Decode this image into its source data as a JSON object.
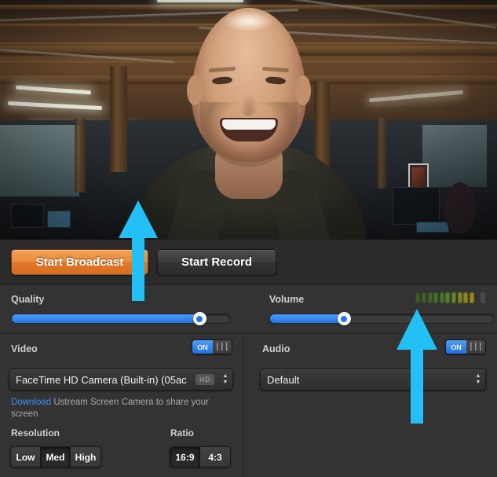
{
  "preview": {
    "name": "webcam-preview",
    "description": "Live webcam preview of a smiling bald man in an open-plan office with exposed wooden ceiling beams"
  },
  "buttons": {
    "broadcast_label": "Start Broadcast",
    "record_label": "Start Record",
    "broadcast_color": "#e8872f",
    "record_color": "#3a3a3a"
  },
  "quality": {
    "label": "Quality",
    "value_percent": 86,
    "accent": "#2176e8"
  },
  "volume": {
    "label": "Volume",
    "value_percent": 33,
    "accent": "#2176e8",
    "meter": {
      "segments": 10,
      "colors": [
        "#3f5c2a",
        "#41612b",
        "#44672c",
        "#48702d",
        "#4c772e",
        "#56832f",
        "#66862c",
        "#7d8a27",
        "#8e8a22",
        "#9a8a1e"
      ],
      "peak_color": "#4a4a4a"
    }
  },
  "video_panel": {
    "title": "Video",
    "toggle": {
      "on_label": "ON",
      "off_icon": "pause-bars-icon",
      "state": "on"
    },
    "device": {
      "value": "FaceTime HD Camera (Built-in) (05ac",
      "badge": "HD",
      "stepper_icon": "stepper-up-down-icon"
    },
    "hint": {
      "link_label": "Download",
      "text": "Ustream Screen Camera to share your screen"
    },
    "resolution": {
      "label": "Resolution",
      "options": [
        "Low",
        "Med",
        "High"
      ],
      "selected": "Med"
    },
    "ratio": {
      "label": "Ratio",
      "options": [
        "16:9",
        "4:3"
      ],
      "selected": "16:9"
    }
  },
  "audio_panel": {
    "title": "Audio",
    "toggle": {
      "on_label": "ON",
      "off_icon": "pause-bars-icon",
      "state": "on"
    },
    "device": {
      "value": "Default",
      "stepper_icon": "stepper-up-down-icon"
    }
  },
  "annotations": {
    "color": "#22c0f4",
    "arrows": [
      {
        "name": "arrow-pointing-start-broadcast",
        "target": "Start Broadcast button"
      },
      {
        "name": "arrow-pointing-volume-meter",
        "target": "Volume level meter"
      }
    ]
  }
}
